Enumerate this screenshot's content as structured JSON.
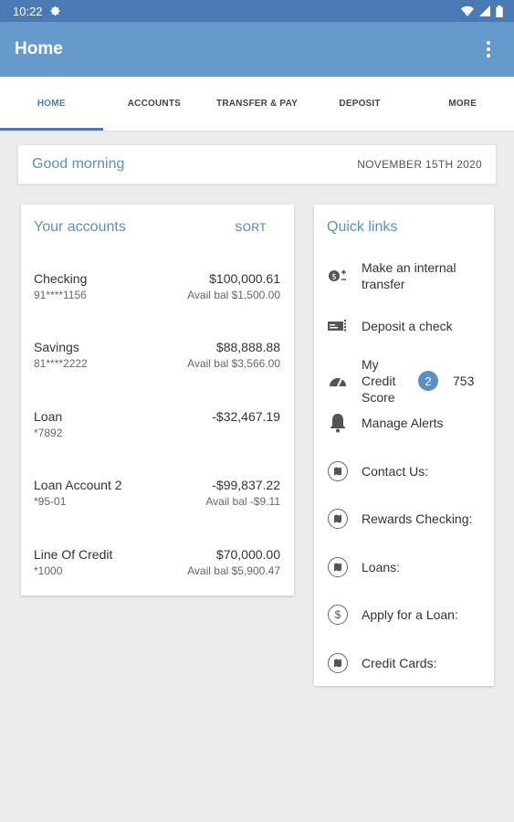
{
  "status": {
    "time": "10:22"
  },
  "appbar": {
    "title": "Home"
  },
  "tabs": [
    {
      "label": "HOME",
      "active": true
    },
    {
      "label": "ACCOUNTS"
    },
    {
      "label": "TRANSFER & PAY"
    },
    {
      "label": "DEPOSIT"
    },
    {
      "label": "MORE"
    }
  ],
  "greeting": {
    "text": "Good morning",
    "date": "NOVEMBER 15TH 2020"
  },
  "accounts": {
    "title": "Your accounts",
    "sort_label": "SORT",
    "items": [
      {
        "name": "Checking",
        "number": "91****1156",
        "balance": "$100,000.61",
        "avail": "Avail bal $1,500.00"
      },
      {
        "name": "Savings",
        "number": "81****2222",
        "balance": "$88,888.88",
        "avail": "Avail bal $3,566.00"
      },
      {
        "name": "Loan",
        "number": "*7892",
        "balance": "-$32,467.19",
        "avail": ""
      },
      {
        "name": "Loan Account 2",
        "number": "*95-01",
        "balance": "-$99,837.22",
        "avail": "Avail bal -$9.11"
      },
      {
        "name": "Line Of Credit",
        "number": "*1000",
        "balance": "$70,000.00",
        "avail": "Avail bal $5,900.47"
      }
    ]
  },
  "quick_links": {
    "title": "Quick links",
    "items": [
      {
        "label": "Make an internal transfer",
        "icon": "transfer-icon"
      },
      {
        "label": "Deposit a check",
        "icon": "check-deposit-icon"
      },
      {
        "label": "My Credit Score",
        "icon": "speedometer-icon",
        "badge": "2",
        "score": "753"
      },
      {
        "label": "Manage Alerts",
        "icon": "bell-icon"
      },
      {
        "label": "Contact Us:",
        "icon": "map-icon"
      },
      {
        "label": "Rewards Checking:",
        "icon": "map-icon"
      },
      {
        "label": "Loans:",
        "icon": "map-icon"
      },
      {
        "label": "Apply for a Loan:",
        "icon": "dollar-icon"
      },
      {
        "label": "Credit Cards:",
        "icon": "map-icon"
      }
    ]
  },
  "colors": {
    "appbar": "#6699cc",
    "statusbar": "#4a7ab5",
    "accent": "#5b8ec4"
  }
}
